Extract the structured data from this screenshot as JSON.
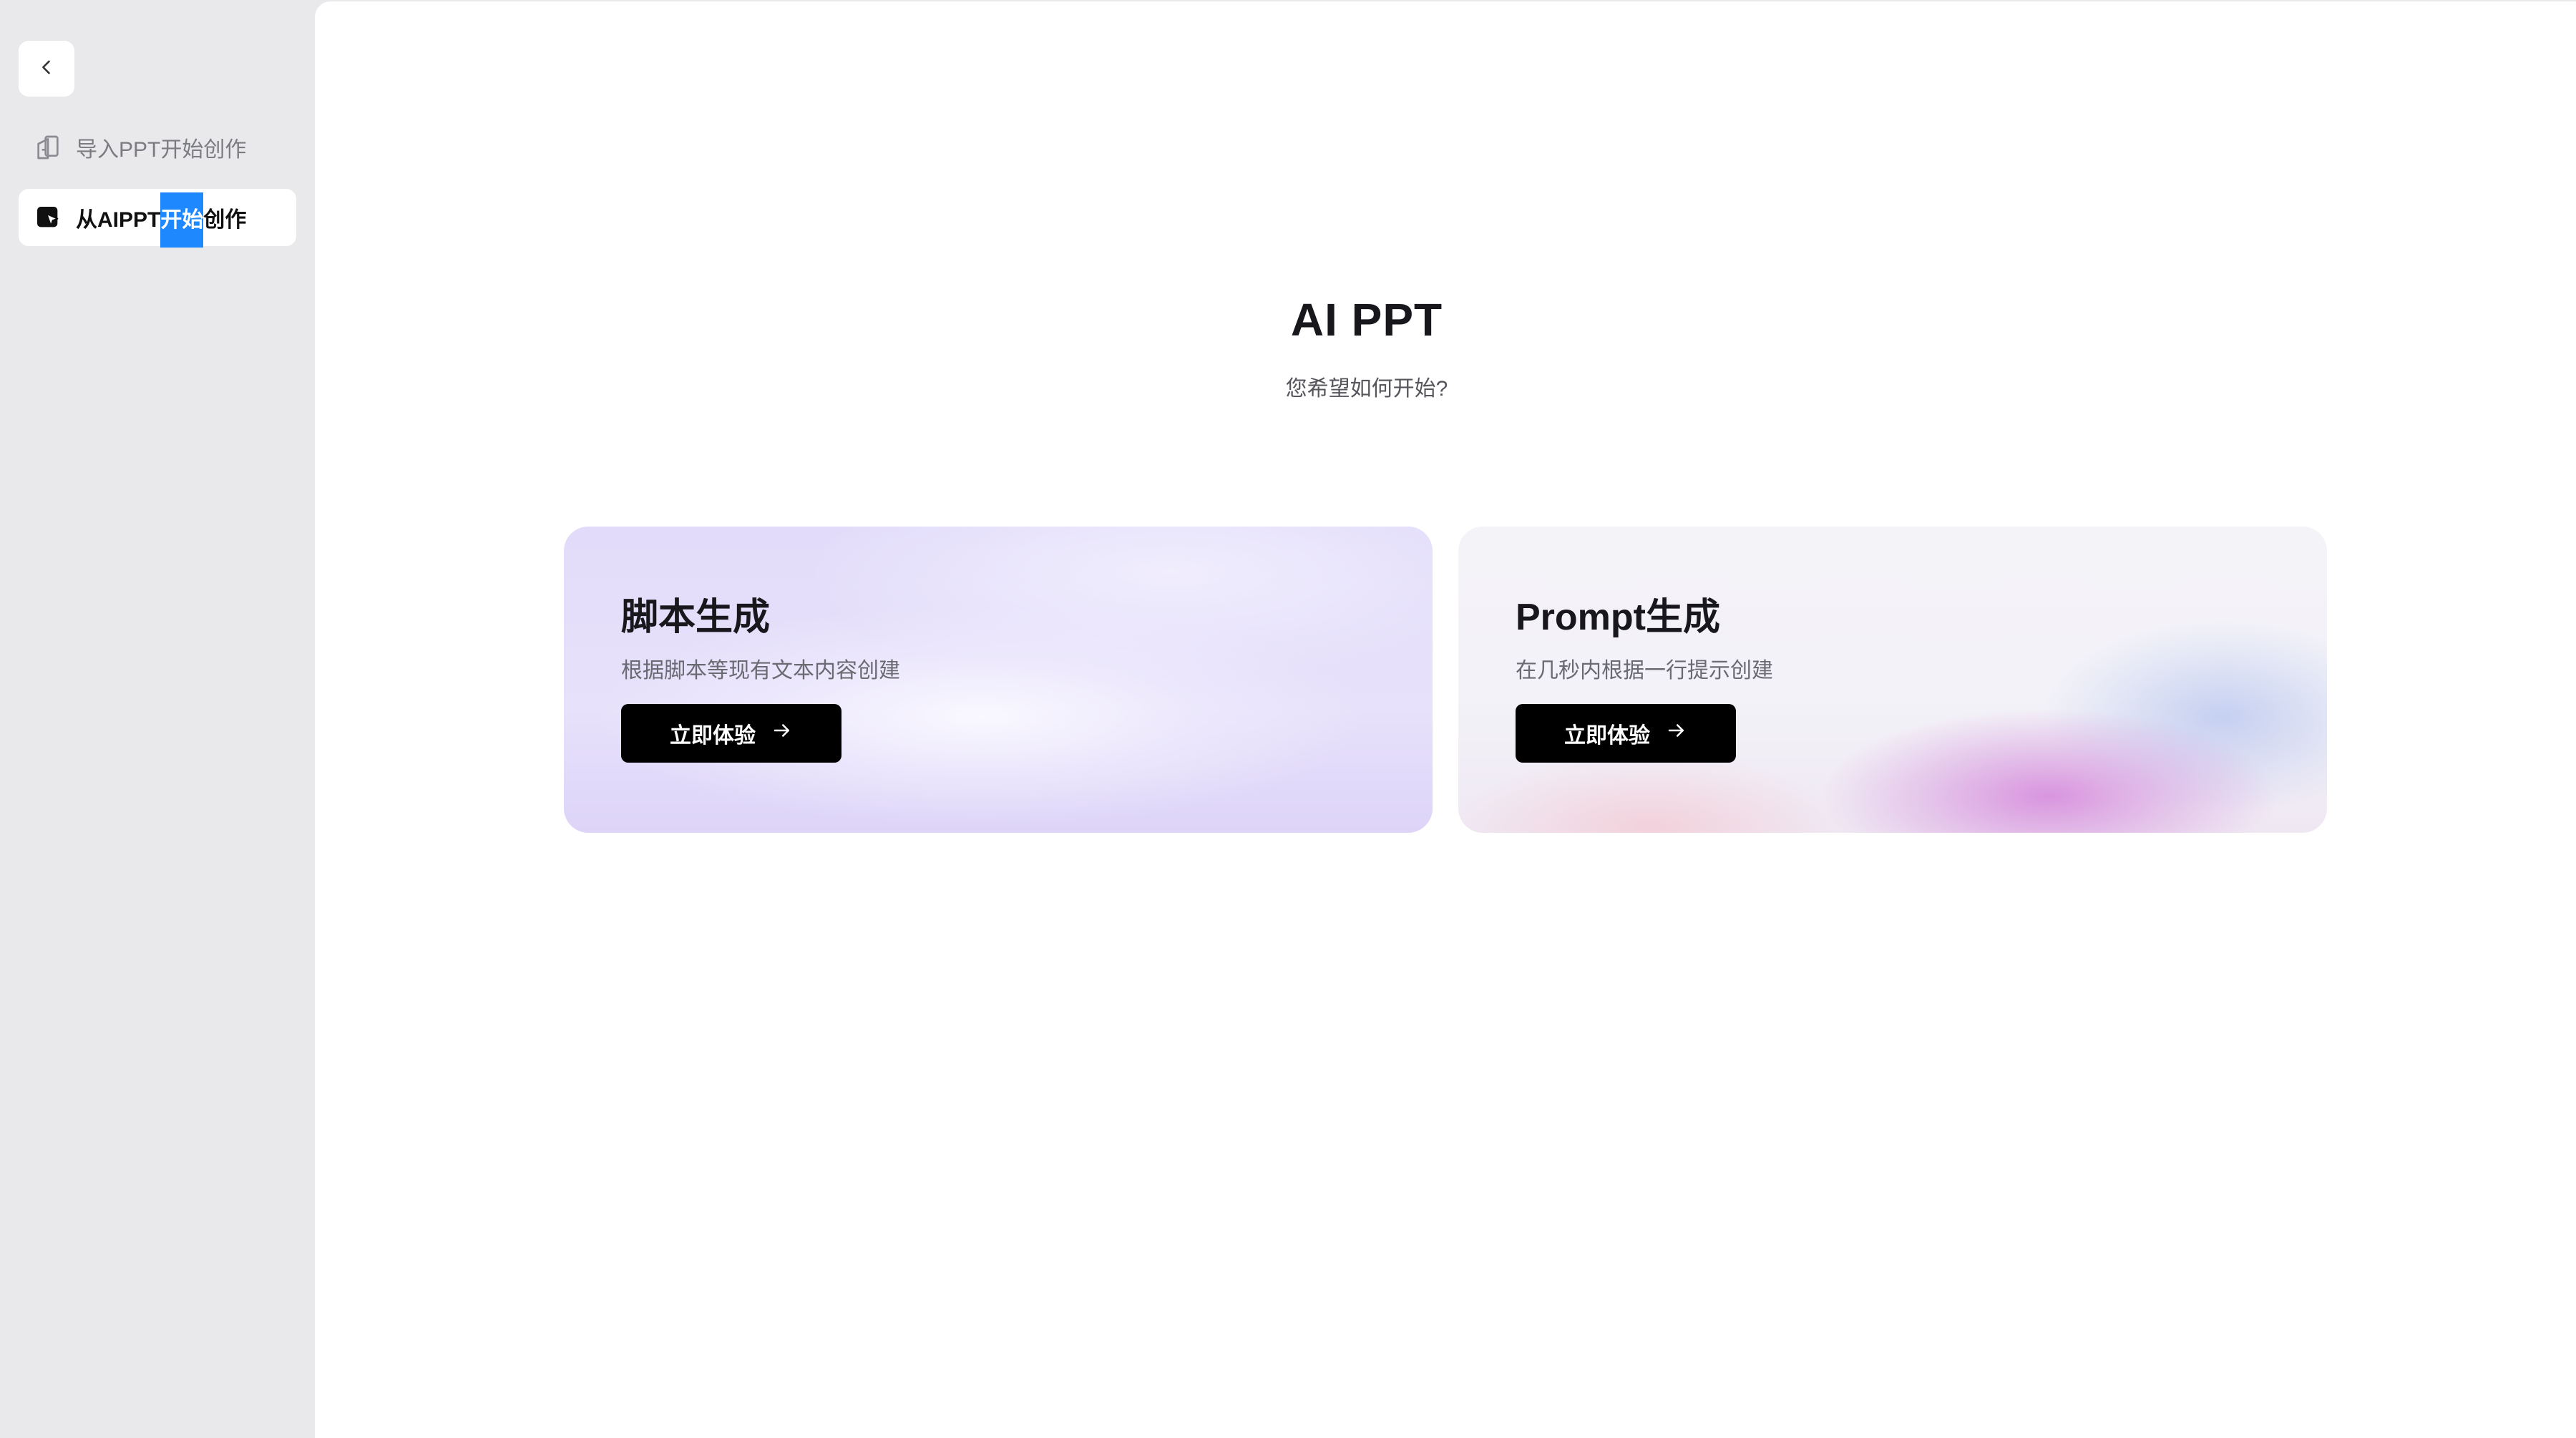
{
  "sidebar": {
    "collapse_icon": "chevron-left-icon",
    "items": [
      {
        "label": "导入PPT开始创作",
        "icon": "import-ppt-icon",
        "active": false
      },
      {
        "label_before": "从AIPPT",
        "label_selected": "开始",
        "label_after": "创作",
        "icon": "aippt-icon",
        "active": true
      }
    ]
  },
  "main": {
    "title": "AI PPT",
    "subtitle": "您希望如何开始?",
    "cards": [
      {
        "title": "脚本生成",
        "description": "根据脚本等现有文本内容创建",
        "button": "立即体验"
      },
      {
        "title": "Prompt生成",
        "description": "在几秒内根据一行提示创建",
        "button": "立即体验"
      }
    ]
  },
  "colors": {
    "sidebar_bg": "#e9e9ec",
    "main_bg": "#ffffff",
    "button_bg": "#000000",
    "selection": "#1e88ff"
  }
}
